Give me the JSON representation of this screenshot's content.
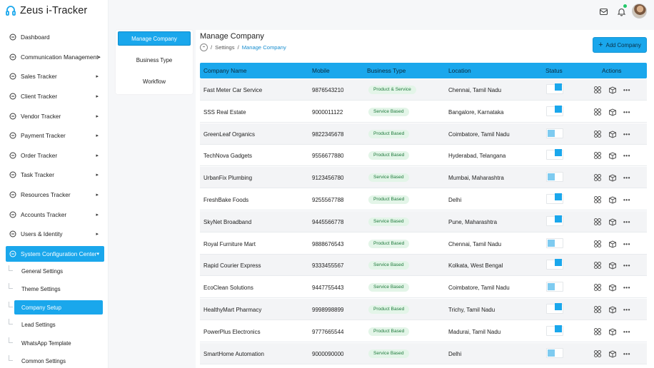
{
  "app": {
    "title": "Zeus i-Tracker"
  },
  "sidebar": {
    "items": [
      {
        "label": "Dashboard",
        "icon": "dashboard-icon",
        "chevron": false
      },
      {
        "label": "Communication Management",
        "icon": "chat-icon",
        "chevron": true
      },
      {
        "label": "Sales Tracker",
        "icon": "sales-icon",
        "chevron": true
      },
      {
        "label": "Client Tracker",
        "icon": "client-icon",
        "chevron": true
      },
      {
        "label": "Vendor Tracker",
        "icon": "vendor-icon",
        "chevron": true
      },
      {
        "label": "Payment Tracker",
        "icon": "payment-icon",
        "chevron": true
      },
      {
        "label": "Order Tracker",
        "icon": "order-icon",
        "chevron": true
      },
      {
        "label": "Task Tracker",
        "icon": "task-icon",
        "chevron": true
      },
      {
        "label": "Resources Tracker",
        "icon": "resources-icon",
        "chevron": true
      },
      {
        "label": "Accounts Tracker",
        "icon": "accounts-icon",
        "chevron": true
      },
      {
        "label": "Users & Identity",
        "icon": "users-icon",
        "chevron": true
      },
      {
        "label": "System Configuration Center",
        "icon": "settings-icon",
        "chevron": true,
        "active": true
      }
    ],
    "sub_items": [
      {
        "label": "General Settings"
      },
      {
        "label": "Theme Settings"
      },
      {
        "label": "Company Setup",
        "active": true
      },
      {
        "label": "Lead Settings"
      },
      {
        "label": "WhatsApp Template"
      },
      {
        "label": "Common Settings"
      }
    ]
  },
  "subnav": {
    "items": [
      {
        "label": "Manage Company",
        "active": true
      },
      {
        "label": "Business Type"
      },
      {
        "label": "Workflow"
      }
    ]
  },
  "page": {
    "title": "Manage Company",
    "breadcrumb": {
      "sep": "/",
      "parent": "Settings",
      "current": "Manage Company"
    },
    "add_button": "Add Company"
  },
  "table": {
    "columns": [
      "Company Name",
      "Mobile",
      "Business Type",
      "Location",
      "Status",
      "Actions"
    ],
    "rows": [
      {
        "name": "Fast Meter Car Service",
        "mobile": "9876543210",
        "type": "Product & Service",
        "location": "Chennai, Tamil Nadu",
        "status": "on"
      },
      {
        "name": "SSS Real Estate",
        "mobile": "9000011122",
        "type": "Service Based",
        "location": "Bangalore, Karnataka",
        "status": "on"
      },
      {
        "name": "GreenLeaf Organics",
        "mobile": "9822345678",
        "type": "Product Based",
        "location": "Coimbatore, Tamil Nadu",
        "status": "off"
      },
      {
        "name": "TechNova Gadgets",
        "mobile": "9556677880",
        "type": "Product Based",
        "location": "Hyderabad, Telangana",
        "status": "on"
      },
      {
        "name": "UrbanFix Plumbing",
        "mobile": "9123456780",
        "type": "Service Based",
        "location": "Mumbai, Maharashtra",
        "status": "off"
      },
      {
        "name": "FreshBake Foods",
        "mobile": "9255567788",
        "type": "Product Based",
        "location": "Delhi",
        "status": "on"
      },
      {
        "name": "SkyNet Broadband",
        "mobile": "9445566778",
        "type": "Service Based",
        "location": "Pune, Maharashtra",
        "status": "on"
      },
      {
        "name": "Royal Furniture Mart",
        "mobile": "9888676543",
        "type": "Product Based",
        "location": "Chennai, Tamil Nadu",
        "status": "off"
      },
      {
        "name": "Rapid Courier Express",
        "mobile": "9333455567",
        "type": "Service Based",
        "location": "Kolkata, West Bengal",
        "status": "on"
      },
      {
        "name": "EcoClean Solutions",
        "mobile": "9447755443",
        "type": "Service Based",
        "location": "Coimbatore, Tamil Nadu",
        "status": "off"
      },
      {
        "name": "HealthyMart Pharmacy",
        "mobile": "9998998899",
        "type": "Product Based",
        "location": "Trichy, Tamil Nadu",
        "status": "on"
      },
      {
        "name": "PowerPlus Electronics",
        "mobile": "9777665544",
        "type": "Product Based",
        "location": "Madurai, Tamil Nadu",
        "status": "on"
      },
      {
        "name": "SmartHome Automation",
        "mobile": "9000090000",
        "type": "Service Based",
        "location": "Delhi",
        "status": "off"
      }
    ],
    "actions_more": "•••"
  },
  "colors": {
    "accent": "#1aa7ec",
    "badge_bg": "#e3f5e8",
    "badge_text": "#1f7a3c"
  }
}
